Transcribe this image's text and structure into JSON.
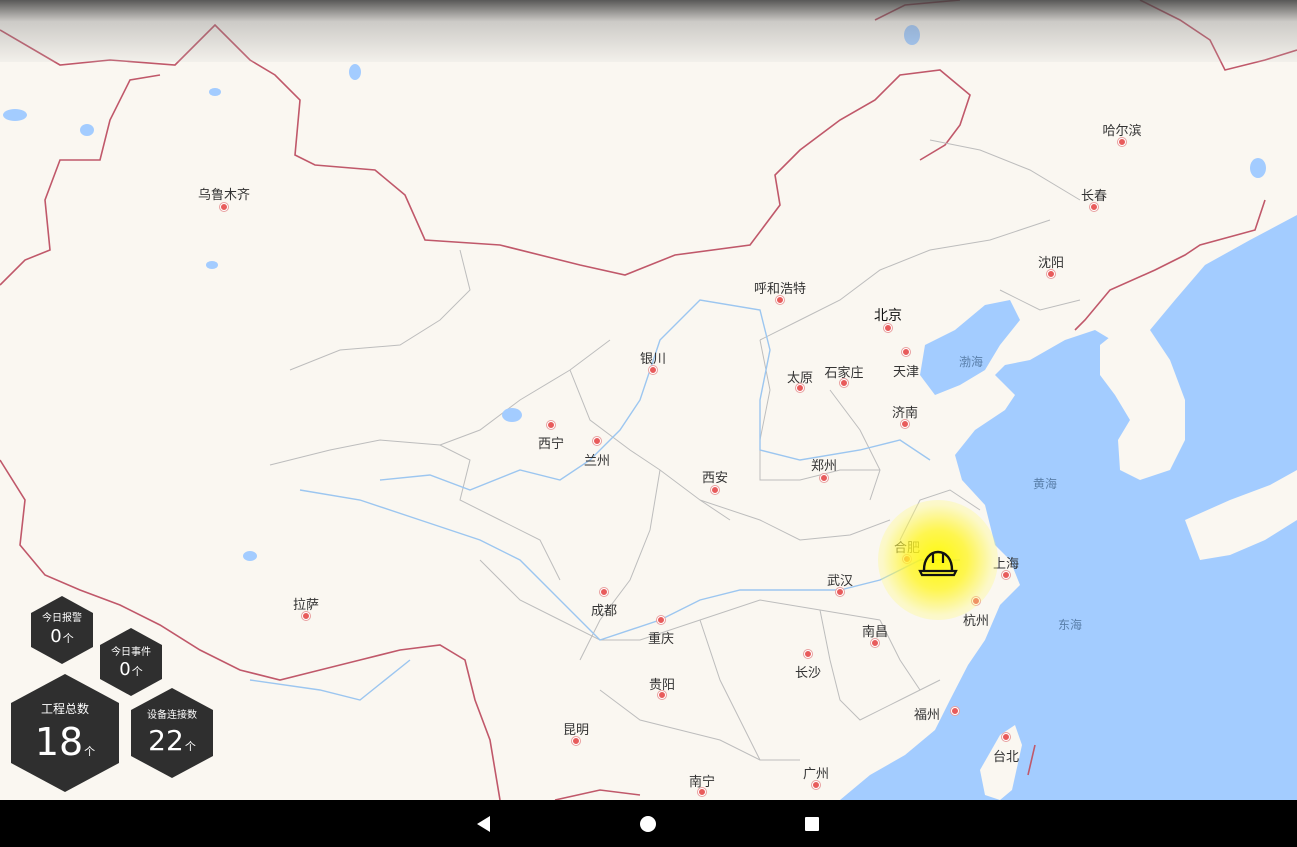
{
  "map": {
    "cities": [
      {
        "name": "乌鲁木齐"
      },
      {
        "name": "哈尔滨"
      },
      {
        "name": "长春"
      },
      {
        "name": "沈阳"
      },
      {
        "name": "呼和浩特"
      },
      {
        "name": "北京"
      },
      {
        "name": "天津"
      },
      {
        "name": "银川"
      },
      {
        "name": "太原"
      },
      {
        "name": "石家庄"
      },
      {
        "name": "济南"
      },
      {
        "name": "西宁"
      },
      {
        "name": "兰州"
      },
      {
        "name": "西安"
      },
      {
        "name": "郑州"
      },
      {
        "name": "合肥"
      },
      {
        "name": "上海"
      },
      {
        "name": "武汉"
      },
      {
        "name": "杭州"
      },
      {
        "name": "南昌"
      },
      {
        "name": "拉萨"
      },
      {
        "name": "成都"
      },
      {
        "name": "重庆"
      },
      {
        "name": "长沙"
      },
      {
        "name": "贵阳"
      },
      {
        "name": "福州"
      },
      {
        "name": "台北"
      },
      {
        "name": "昆明"
      },
      {
        "name": "南宁"
      },
      {
        "name": "广州"
      }
    ],
    "seas": [
      {
        "name": "渤海"
      },
      {
        "name": "黄海"
      },
      {
        "name": "东海"
      }
    ],
    "marker": {
      "icon": "hardhat-icon",
      "glow_color": "#fff600"
    }
  },
  "stats": {
    "alarms_today": {
      "label": "今日报警",
      "value": "0",
      "unit": "个"
    },
    "events_today": {
      "label": "今日事件",
      "value": "0",
      "unit": "个"
    },
    "projects_total": {
      "label": "工程总数",
      "value": "18",
      "unit": "个"
    },
    "devices_connected": {
      "label": "设备连接数",
      "value": "22",
      "unit": "个"
    }
  },
  "navbar": {
    "back": "back-icon",
    "home": "home-icon",
    "recents": "recents-icon"
  },
  "colors": {
    "land": "#faf7f1",
    "water": "#a3ccff",
    "border": "#c0586a",
    "province": "#bdbdbd",
    "hex_bg": "#2f2f2f"
  }
}
